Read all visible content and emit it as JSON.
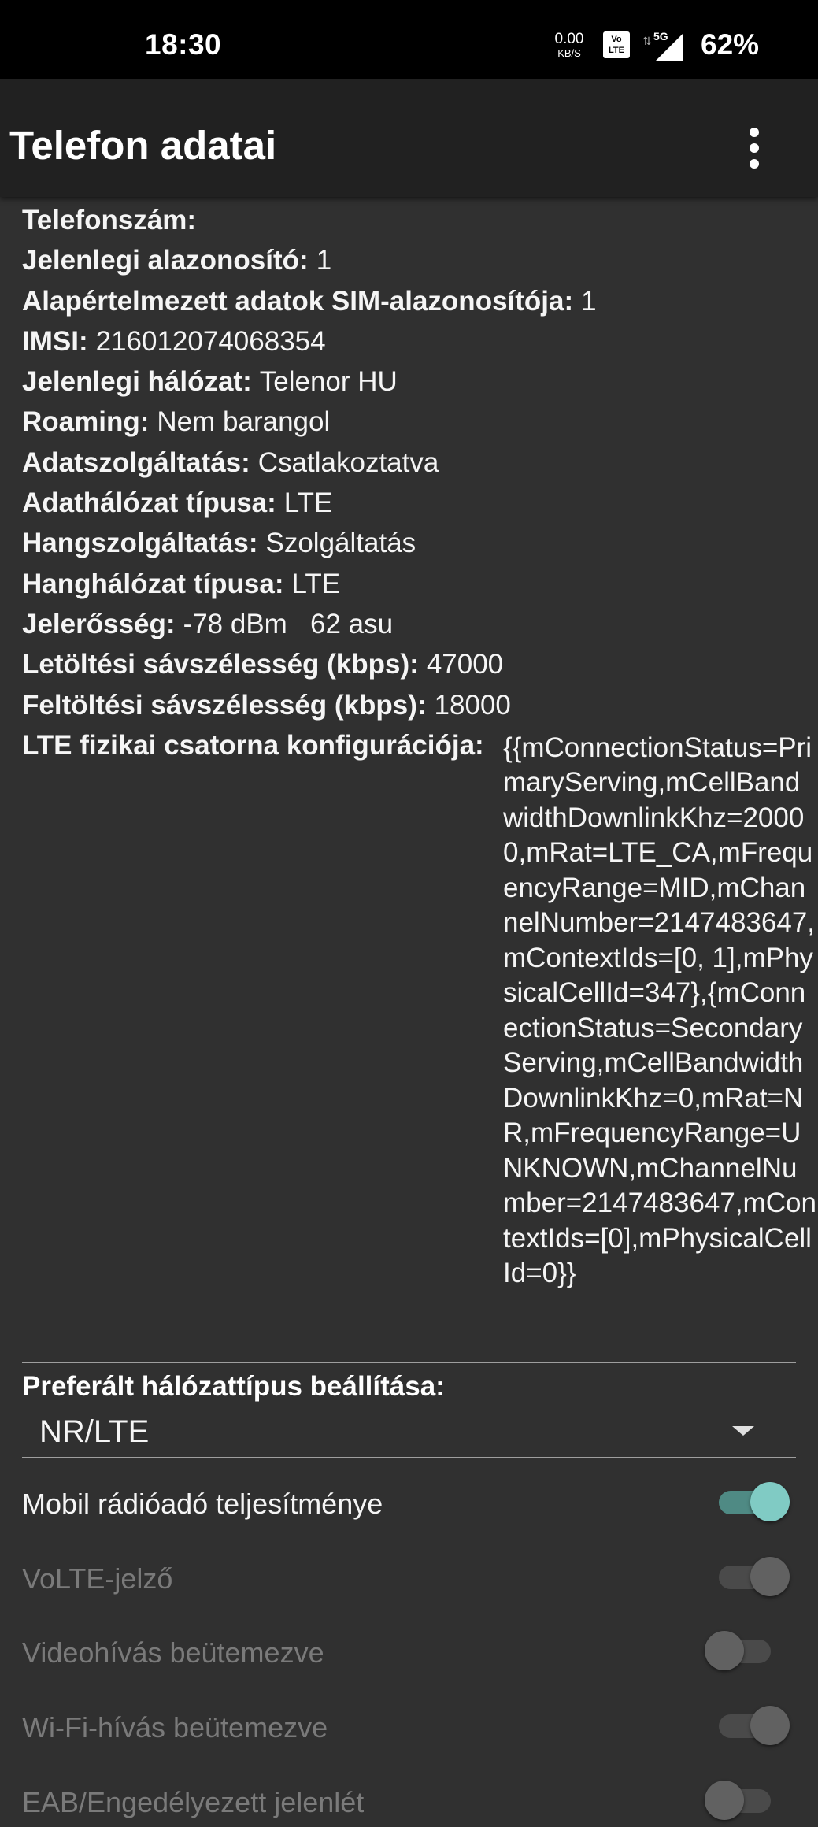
{
  "status_bar": {
    "time": "18:30",
    "speed_value": "0.00",
    "speed_unit": "KB/S",
    "volte_icon": "Vo LTE",
    "network": "5G",
    "battery": "62%"
  },
  "app_bar": {
    "title": "Telefon adatai",
    "menu_icon": "more-vert-icon"
  },
  "info": {
    "phone_number": {
      "label": "Telefonszám:",
      "value": ""
    },
    "current_id": {
      "label": "Jelenlegi alazonosító:",
      "value": "1"
    },
    "default_data_sim": {
      "label": "Alapértelmezett adatok SIM-alazonosítója:",
      "value": "1"
    },
    "imsi": {
      "label": "IMSI:",
      "value": "216012074068354"
    },
    "current_network": {
      "label": "Jelenlegi hálózat:",
      "value": "Telenor HU"
    },
    "roaming": {
      "label": "Roaming:",
      "value": "Nem barangol"
    },
    "data_service": {
      "label": "Adatszolgáltatás:",
      "value": "Csatlakoztatva"
    },
    "data_network_type": {
      "label": "Adathálózat típusa:",
      "value": "LTE"
    },
    "voice_service": {
      "label": "Hangszolgáltatás:",
      "value": "Szolgáltatás"
    },
    "voice_network_type": {
      "label": "Hanghálózat típusa:",
      "value": "LTE"
    },
    "signal_strength": {
      "label": "Jelerősség:",
      "value": "-78 dBm   62 asu"
    },
    "download_bandwidth": {
      "label": "Letöltési sávszélesség (kbps):",
      "value": "47000"
    },
    "upload_bandwidth": {
      "label": "Feltöltési sávszélesség (kbps):",
      "value": "18000"
    },
    "lte_phys_config": {
      "label": "LTE fizikai csatorna konfigurációja:",
      "value": "{{mConnectionStatus=PrimaryServing,mCellBandwidthDownlinkKhz=20000,mRat=LTE_CA,mFrequencyRange=MID,mChannelNumber=2147483647,mContextIds=[0, 1],mPhysicalCellId=347},{mConnectionStatus=SecondaryServing,mCellBandwidthDownlinkKhz=0,mRat=NR,mFrequencyRange=UNKNOWN,mChannelNumber=2147483647,mContextIds=[0],mPhysicalCellId=0}}"
    }
  },
  "preferred_network": {
    "label": "Preferált hálózattípus beállítása:",
    "selected": "NR/LTE"
  },
  "toggles": [
    {
      "label": "Mobil rádióadó teljesítménye",
      "checked": true,
      "enabled": true
    },
    {
      "label": "VoLTE-jelző",
      "checked": true,
      "enabled": false
    },
    {
      "label": "Videohívás beütemezve",
      "checked": false,
      "enabled": false
    },
    {
      "label": "Wi-Fi-hívás beütemezve",
      "checked": true,
      "enabled": false
    },
    {
      "label": "EAB/Engedélyezett jelenlét",
      "checked": false,
      "enabled": false
    }
  ],
  "colors": {
    "background": "#303030",
    "app_bar": "#212121",
    "accent_track": "#4f8a84",
    "accent_thumb": "#80cbc4",
    "disabled_thumb": "#616161",
    "disabled_track": "#4a4a4a"
  }
}
